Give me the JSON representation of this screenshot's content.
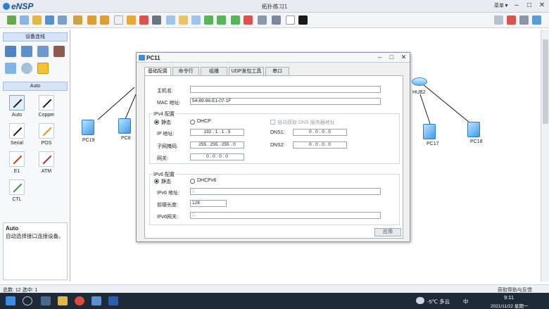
{
  "app": {
    "logo": "eNSP",
    "title": "拓扑练习1",
    "menu_label": "菜单▼"
  },
  "left_panel": {
    "devices_header": "设备连线",
    "conn_header": "Auto",
    "connections": [
      {
        "label": "Auto",
        "color": "#1a1a1a"
      },
      {
        "label": "Copper",
        "color": "#1a1a1a"
      },
      {
        "label": "Serial",
        "color": "#1a1a1a"
      },
      {
        "label": "POS",
        "color": "#e8892a"
      },
      {
        "label": "E1",
        "color": "#c0392b"
      },
      {
        "label": "ATM",
        "color": "#a0322d"
      },
      {
        "label": "CTL",
        "color": "#3c8f4a"
      }
    ],
    "desc_title": "Auto",
    "desc_text": "自动选择接口连接设备。"
  },
  "canvas": {
    "nodes": [
      {
        "label": "PC19"
      },
      {
        "label": "PC8"
      },
      {
        "label": "PC17"
      },
      {
        "label": "PC18"
      },
      {
        "label": "HUB2"
      }
    ]
  },
  "dialog": {
    "title": "PC11",
    "tabs": [
      "基础配置",
      "命令行",
      "组播",
      "UDP发包工具",
      "串口"
    ],
    "active_tab": "基础配置",
    "hostname_label": "主机名:",
    "hostname_value": "",
    "mac_label": "MAC 地址:",
    "mac_value": "54-89-98-E1-07-1F",
    "ipv4_group": "IPv4 配置",
    "ipv4_static": "静态",
    "ipv4_dhcp": "DHCP",
    "auto_dns": "自动获取 DNS 服务器地址",
    "ip_label": "IP 地址:",
    "ip_value": "192 . 1 . 1 . 5",
    "mask_label": "子网掩码:",
    "mask_value": "255 . 255 . 255 . 0",
    "gateway_label": "网关:",
    "gateway_value": "0 . 0 . 0 . 0",
    "dns1_label": "DNS1:",
    "dns1_value": "0 . 0 . 0 . 0",
    "dns2_label": "DNS2:",
    "dns2_value": "0 . 0 . 0 . 0",
    "ipv6_group": "IPv6 配置",
    "ipv6_static": "静态",
    "ipv6_dhcp": "DHCPv6",
    "ipv6_addr_label": "IPv6 地址:",
    "ipv6_addr_value": "::",
    "prefix_label": "前缀长度:",
    "prefix_value": "128",
    "ipv6_gw_label": "IPv6网关:",
    "ipv6_gw_value": "::",
    "apply_label": "应用"
  },
  "status": {
    "left": "总数: 12 选中: 1",
    "right": "获取帮助与反馈"
  },
  "taskbar": {
    "weather": "-5℃ 多云",
    "ime": "中",
    "time": "9:11",
    "date": "2021/11/22 星期一"
  }
}
